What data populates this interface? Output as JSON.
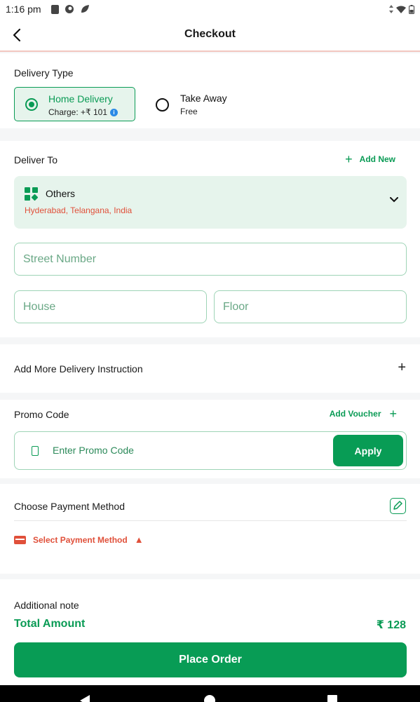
{
  "status_bar": {
    "time": "1:16 pm"
  },
  "header": {
    "title": "Checkout"
  },
  "delivery_type": {
    "label": "Delivery Type",
    "selected": "home_delivery",
    "home_delivery": {
      "title": "Home Delivery",
      "charge": "Charge: +₹ 101"
    },
    "take_away": {
      "title": "Take Away",
      "sub": "Free"
    }
  },
  "deliver_to": {
    "label": "Deliver To",
    "add_new": "Add New",
    "address": {
      "name": "Others",
      "line": "Hyderabad, Telangana, India"
    },
    "street_placeholder": "Street Number",
    "house_placeholder": "House",
    "floor_placeholder": "Floor"
  },
  "instruction": {
    "label": "Add More Delivery Instruction"
  },
  "promo": {
    "label": "Promo Code",
    "add_voucher": "Add Voucher",
    "placeholder": "Enter Promo Code",
    "apply": "Apply"
  },
  "payment": {
    "label": "Choose Payment Method",
    "select": "Select Payment Method"
  },
  "note": {
    "label": "Additional note"
  },
  "summary": {
    "total_label": "Total Amount",
    "total_value": "₹ 128"
  },
  "place_order": "Place Order",
  "colors": {
    "primary": "#089c55",
    "error": "#e0503a",
    "accent_bg": "#e6f4ec"
  }
}
